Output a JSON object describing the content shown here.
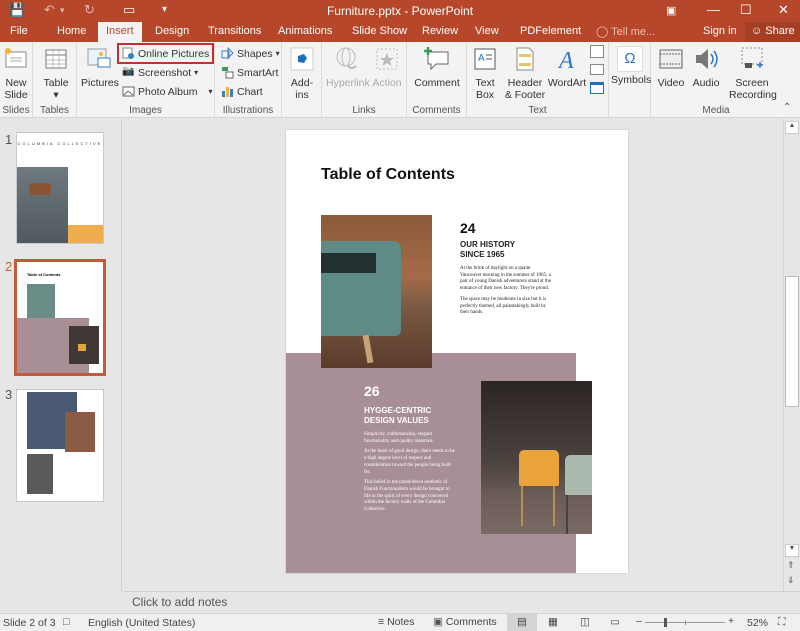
{
  "window": {
    "title": "Furniture.pptx - PowerPoint",
    "icons": [
      "save-icon",
      "undo-icon",
      "redo-icon",
      "present-from-start-icon",
      "customize-qat-icon"
    ],
    "controls": [
      "ribbon-display-options-icon",
      "minimize-icon",
      "maximize-icon",
      "close-icon"
    ]
  },
  "tabs": [
    {
      "label": "File"
    },
    {
      "label": "Home"
    },
    {
      "label": "Insert",
      "active": true
    },
    {
      "label": "Design"
    },
    {
      "label": "Transitions"
    },
    {
      "label": "Animations"
    },
    {
      "label": "Slide Show"
    },
    {
      "label": "Review"
    },
    {
      "label": "View"
    },
    {
      "label": "PDFelement"
    }
  ],
  "tell_me": "Tell me...",
  "sign_in": "Sign in",
  "share": "Share",
  "ribbon": {
    "groups": {
      "slides": "Slides",
      "tables": "Tables",
      "images": "Images",
      "illustrations": "Illustrations",
      "addins": "",
      "links": "Links",
      "comments": "Comments",
      "text": "Text",
      "symbols": "",
      "media": "Media"
    },
    "new_slide": "New\nSlide",
    "table": "Table",
    "pictures": "Pictures",
    "online_pictures": "Online Pictures",
    "screenshot": "Screenshot",
    "photo_album": "Photo Album",
    "shapes": "Shapes",
    "smartart": "SmartArt",
    "chart": "Chart",
    "addins": "Add-ins",
    "hyperlink": "Hyperlink",
    "action": "Action",
    "comment": "Comment",
    "text_box": "Text Box",
    "header_footer": "Header & Footer",
    "wordart": "WordArt",
    "symbols": "Symbols",
    "video": "Video",
    "audio": "Audio",
    "screen_recording": "Screen Recording"
  },
  "thumbnails": [
    {
      "number": "1",
      "title": "COLUMBIA COLLECTIVE",
      "selected": false
    },
    {
      "number": "2",
      "title": "Table of Contents",
      "selected": true
    },
    {
      "number": "3",
      "title": "",
      "selected": false
    }
  ],
  "slide": {
    "title": "Table of Contents",
    "section1": {
      "number": "24",
      "heading_line1": "OUR HISTORY",
      "heading_line2": "SINCE 1965",
      "para1": "At the brink of daylight on a quaint Vancouver morning in the summer of 1965, a pair of young Danish adventurers stand at the entrance of their new factory. They're proud.",
      "para2": "The space may be moderate in size but it is perfectly themed, all painstakingly built by their hands."
    },
    "section2": {
      "number": "26",
      "heading_line1": "HYGGE-CENTRIC",
      "heading_line2": "DESIGN VALUES",
      "para1": "Simplicity, craftsmanship, elegant functionality and quality materials.",
      "para2": "At the heart of good design, there needs to be a high degree level of respect and consideration toward the people being built for.",
      "para3": "This belief in the pared-down aesthetic of Danish Functionalism would be brought to life in the spirit of every design conceived within the factory walls of the Columbia Collective."
    },
    "colors": {
      "mauve": "#a88f96",
      "accent": "#b7472a"
    }
  },
  "notes_placeholder": "Click to add notes",
  "status": {
    "slide_indicator": "Slide 2 of 3",
    "language": "English (United States)",
    "notes": "Notes",
    "comments": "Comments",
    "zoom": "52%",
    "zoom_fraction": 0.52
  }
}
